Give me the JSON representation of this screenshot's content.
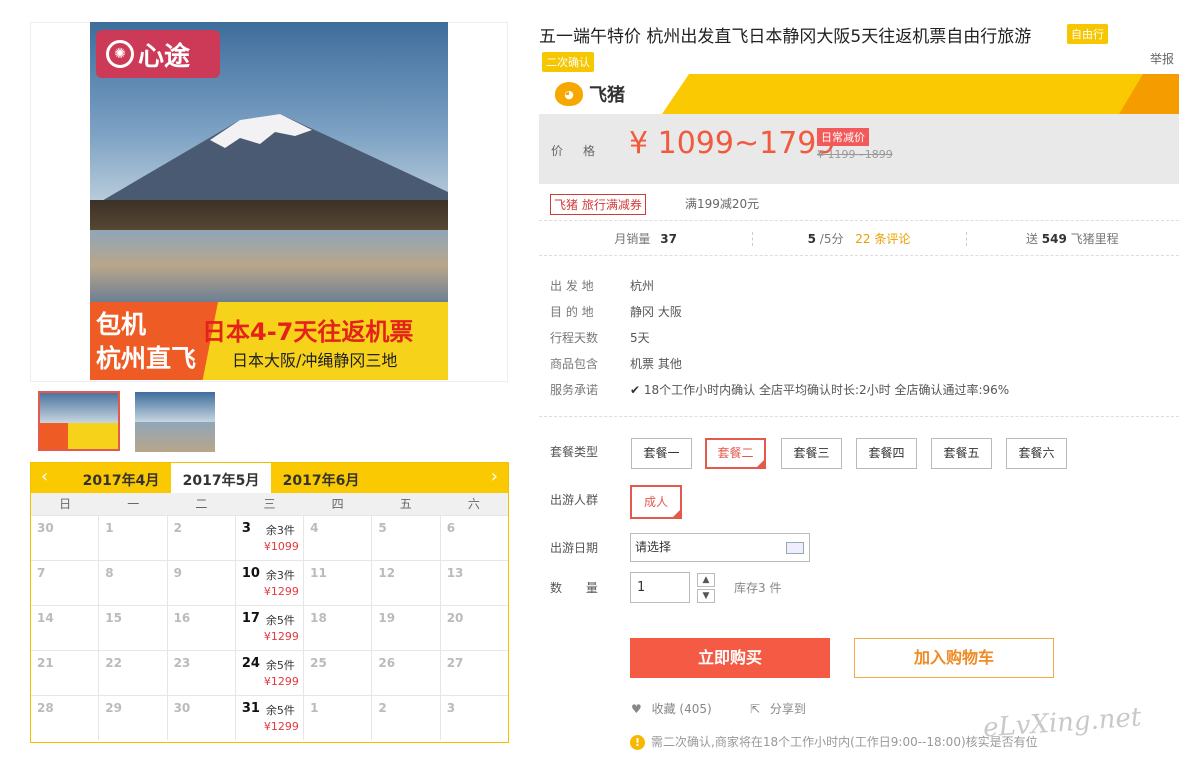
{
  "product": {
    "title": "五一端午特价 杭州出发直飞日本静冈大阪5天往返机票自由行旅游",
    "tag_free": "自由行",
    "tag_confirm": "二次确认",
    "report": "举报"
  },
  "brand": {
    "name": "飞猪",
    "icon": "pig-logo-icon",
    "color": "#fbc901"
  },
  "price": {
    "label": "价格",
    "value": "¥ 1099~1799",
    "discount_tag": "日常减价",
    "original": "¥ 1199~1899"
  },
  "coupon": {
    "badge": "飞猪 旅行满减券",
    "text": "满199减20元"
  },
  "stats": {
    "monthly_sales_label": "月销量",
    "monthly_sales": "37",
    "rating": "5",
    "rating_suffix": "/5分",
    "reviews": "22 条评论",
    "miles_prefix": "送",
    "miles": "549",
    "miles_suffix": "飞猪里程"
  },
  "info": [
    {
      "label": "出 发 地",
      "value": "杭州"
    },
    {
      "label": "目 的 地",
      "value": "静冈   大阪"
    },
    {
      "label": "行程天数",
      "value": "5天"
    },
    {
      "label": "商品包含",
      "value": "机票   其他"
    },
    {
      "label": "服务承诺",
      "value": "18个工作小时内确认     全店平均确认时长:2小时     全店确认通过率:96%"
    }
  ],
  "options": {
    "package_label": "套餐类型",
    "packages": [
      "套餐一",
      "套餐二",
      "套餐三",
      "套餐四",
      "套餐五",
      "套餐六"
    ],
    "selected_package": "套餐二",
    "traveler_label": "出游人群",
    "traveler": "成人",
    "date_label": "出游日期",
    "date_placeholder": "请选择",
    "qty_label": "数 量",
    "qty": "1",
    "stock": "库存3 件"
  },
  "actions": {
    "buy": "立即购买",
    "cart": "加入购物车",
    "fav": "收藏 (405)",
    "share": "分享到"
  },
  "notice": "需二次确认,商家将在18个工作小时内(工作日9:00--18:00)核实是否有位",
  "image": {
    "logo_text": "心途",
    "banner_left": [
      "包机",
      "杭州直飞"
    ],
    "banner_right_1": "日本4-7天往返机票",
    "banner_right_2": "日本大阪/冲绳静冈三地"
  },
  "calendar": {
    "prev_month": "2017年4月",
    "current_month": "2017年5月",
    "next_month": "2017年6月",
    "weekdays": [
      "日",
      "一",
      "二",
      "三",
      "四",
      "五",
      "六"
    ],
    "weeks": [
      [
        {
          "d": "30"
        },
        {
          "d": "1"
        },
        {
          "d": "2"
        },
        {
          "d": "3",
          "stock": "余3件",
          "price": "¥1099"
        },
        {
          "d": "4"
        },
        {
          "d": "5"
        },
        {
          "d": "6"
        }
      ],
      [
        {
          "d": "7"
        },
        {
          "d": "8"
        },
        {
          "d": "9"
        },
        {
          "d": "10",
          "stock": "余3件",
          "price": "¥1299"
        },
        {
          "d": "11"
        },
        {
          "d": "12"
        },
        {
          "d": "13"
        }
      ],
      [
        {
          "d": "14"
        },
        {
          "d": "15"
        },
        {
          "d": "16"
        },
        {
          "d": "17",
          "stock": "余5件",
          "price": "¥1299"
        },
        {
          "d": "18"
        },
        {
          "d": "19"
        },
        {
          "d": "20"
        }
      ],
      [
        {
          "d": "21"
        },
        {
          "d": "22"
        },
        {
          "d": "23"
        },
        {
          "d": "24",
          "stock": "余5件",
          "price": "¥1299"
        },
        {
          "d": "25"
        },
        {
          "d": "26"
        },
        {
          "d": "27"
        }
      ],
      [
        {
          "d": "28"
        },
        {
          "d": "29"
        },
        {
          "d": "30"
        },
        {
          "d": "31",
          "stock": "余5件",
          "price": "¥1299"
        },
        {
          "d": "1"
        },
        {
          "d": "2"
        },
        {
          "d": "3"
        }
      ]
    ]
  },
  "watermark": "eLvXing.net"
}
